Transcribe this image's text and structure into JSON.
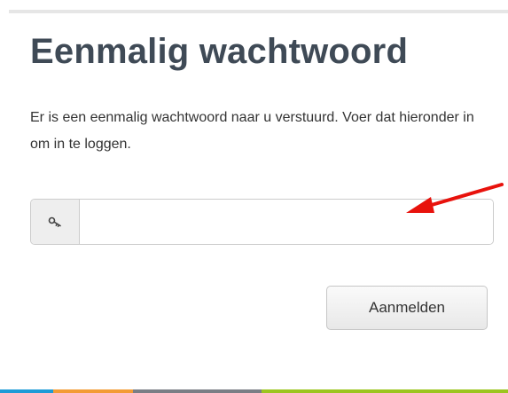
{
  "login": {
    "title": "Eenmalig wachtwoord",
    "instruction": "Er is een eenmalig wachtwoord naar u verstuurd. Voer dat hieronder in om in te loggen.",
    "otp_field": {
      "icon": "key-icon",
      "value": "",
      "placeholder": ""
    },
    "submit_label": "Aanmelden"
  },
  "annotation": {
    "icon": "red-arrow",
    "color": "#e8120c"
  },
  "colors": {
    "title": "#3f4a56",
    "bottom_bar": [
      "#1e9bd7",
      "#f39b35",
      "#7a7e85",
      "#9cc51f"
    ]
  }
}
